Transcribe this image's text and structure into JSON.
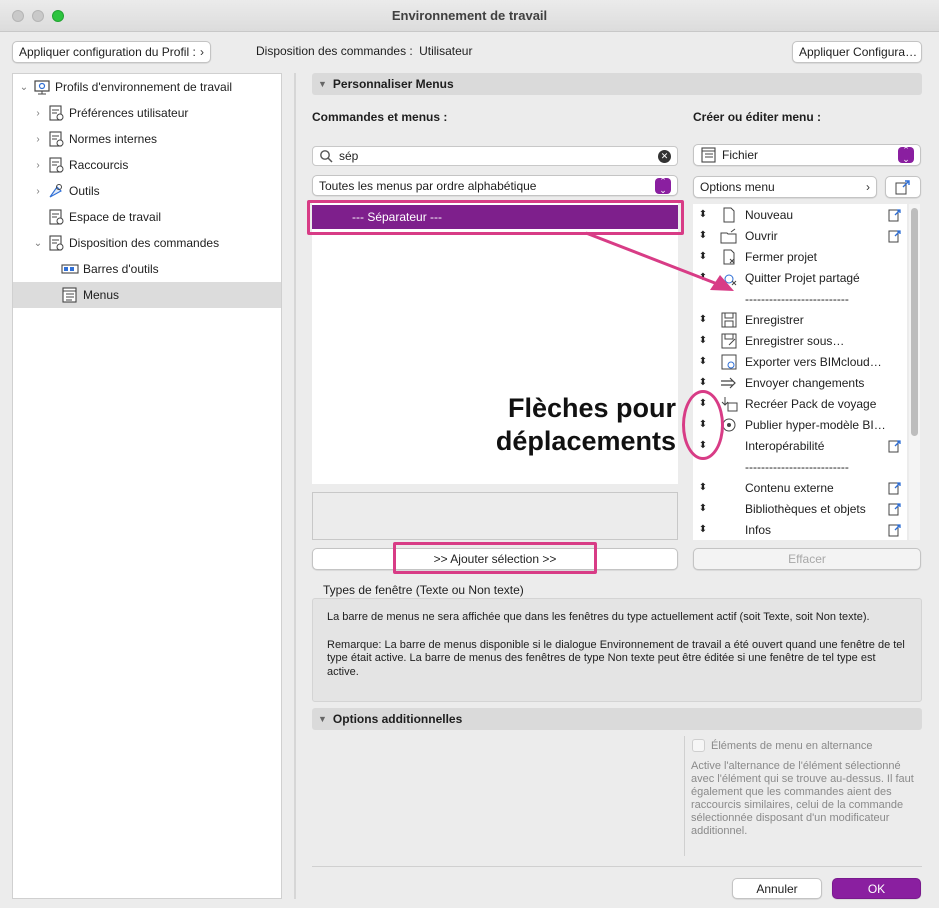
{
  "window": {
    "title": "Environnement de travail"
  },
  "toolbar": {
    "apply_profile": "Appliquer configuration du Profil :",
    "layout_label": "Disposition des commandes :",
    "layout_value": "Utilisateur",
    "apply_config": "Appliquer Configura…"
  },
  "tree": {
    "items": [
      {
        "label": "Profils d'environnement de travail",
        "icon": "profile-icon"
      },
      {
        "label": "Préférences utilisateur",
        "icon": "settings-doc-icon"
      },
      {
        "label": "Normes internes",
        "icon": "settings-doc-icon"
      },
      {
        "label": "Raccourcis",
        "icon": "settings-doc-icon"
      },
      {
        "label": "Outils",
        "icon": "tools-icon"
      },
      {
        "label": "Espace de travail",
        "icon": "settings-doc-icon"
      },
      {
        "label": "Disposition des commandes",
        "icon": "settings-doc-icon"
      },
      {
        "label": "Barres d'outils",
        "icon": "toolbar-icon"
      },
      {
        "label": "Menus",
        "icon": "menu-icon"
      }
    ]
  },
  "customize": {
    "header": "Personnaliser Menus",
    "commands_label": "Commandes et menus :",
    "search_value": "sép",
    "filter_value": "Toutes les menus par ordre alphabétique",
    "selected_item": "--- Séparateur ---",
    "add_button": ">> Ajouter sélection >>",
    "create_label": "Créer ou éditer menu :",
    "menu_select": "Fichier",
    "options_menu": "Options menu",
    "erase_button": "Effacer"
  },
  "menu_items": [
    {
      "label": "Nouveau",
      "trail": true
    },
    {
      "label": "Ouvrir",
      "trail": true
    },
    {
      "label": "Fermer projet",
      "trail": false
    },
    {
      "label": "Quitter Projet partagé",
      "trail": false
    },
    {
      "label": "--------------------------",
      "trail": false
    },
    {
      "label": "Enregistrer",
      "trail": false
    },
    {
      "label": "Enregistrer sous…",
      "trail": false
    },
    {
      "label": "Exporter vers BIMcloud…",
      "trail": false
    },
    {
      "label": "Envoyer changements",
      "trail": false
    },
    {
      "label": "Recréer Pack de voyage",
      "trail": false
    },
    {
      "label": "Publier hyper-modèle BI…",
      "trail": false
    },
    {
      "label": "Interopérabilité",
      "trail": true
    },
    {
      "label": "--------------------------",
      "trail": false
    },
    {
      "label": "Contenu externe",
      "trail": true
    },
    {
      "label": "Bibliothèques et objets",
      "trail": true
    },
    {
      "label": "Infos",
      "trail": true
    }
  ],
  "annotation": {
    "line1": "Flèches pour",
    "line2": "déplacements"
  },
  "window_types": {
    "label": "Types de fenêtre (Texte ou Non texte)",
    "para1": "La barre de menus ne sera affichée que dans les fenêtres du type actuellement actif (soit Texte, soit Non texte).",
    "para2": "Remarque: La barre de menus disponible si le dialogue Environnement de travail a été ouvert quand une fenêtre de tel type était active. La barre de menus des fenêtres de type Non texte peut être éditée si une fenêtre de tel type est active."
  },
  "additional": {
    "header": "Options additionnelles",
    "checkbox_label": "Éléments de menu en alternance",
    "description": "Active l'alternance de l'élément sélectionné avec l'élément qui se trouve au-dessus. Il faut également que les commandes aient des raccourcis similaires, celui de la commande sélectionnée disposant d'un modificateur additionnel."
  },
  "footer": {
    "cancel": "Annuler",
    "ok": "OK"
  },
  "colors": {
    "accent": "#7e1f8c",
    "annotation": "#d83c86",
    "ok_button": "#8a1fa0"
  }
}
